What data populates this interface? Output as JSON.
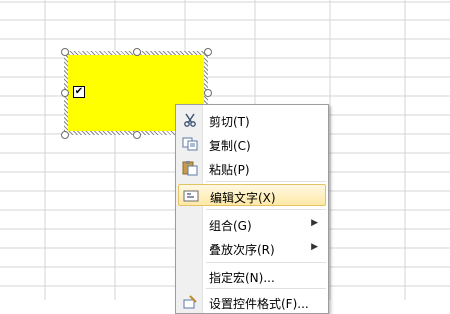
{
  "spreadsheet": {
    "checkbox_mark": "✔",
    "shape_color": "#ffff00"
  },
  "context_menu": {
    "items": [
      {
        "label": "剪切(T)",
        "icon": "scissors-icon",
        "highlighted": false,
        "submenu": false
      },
      {
        "label": "复制(C)",
        "icon": "copy-icon",
        "highlighted": false,
        "submenu": false
      },
      {
        "label": "粘贴(P)",
        "icon": "paste-icon",
        "highlighted": false,
        "submenu": false
      },
      {
        "label": "编辑文字(X)",
        "icon": "edit-text-icon",
        "highlighted": true,
        "submenu": false
      },
      {
        "label": "组合(G)",
        "icon": "",
        "highlighted": false,
        "submenu": true
      },
      {
        "label": "叠放次序(R)",
        "icon": "",
        "highlighted": false,
        "submenu": true
      },
      {
        "label": "指定宏(N)...",
        "icon": "",
        "highlighted": false,
        "submenu": false
      },
      {
        "label": "设置控件格式(F)...",
        "icon": "format-control-icon",
        "highlighted": false,
        "submenu": false
      }
    ],
    "submenu_arrow": "▶"
  }
}
